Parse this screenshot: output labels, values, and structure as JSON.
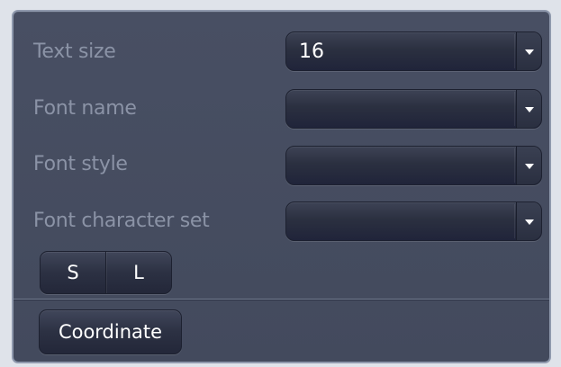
{
  "settings": {
    "rows": [
      {
        "label": "Text size",
        "value": "16"
      },
      {
        "label": "Font name",
        "value": ""
      },
      {
        "label": "Font style",
        "value": ""
      },
      {
        "label": "Font character set",
        "value": ""
      }
    ],
    "size_buttons": {
      "small_label": "S",
      "large_label": "L"
    },
    "coordinate_label": "Coordinate"
  },
  "icons": {
    "dropdown": "chevron-down-icon"
  }
}
